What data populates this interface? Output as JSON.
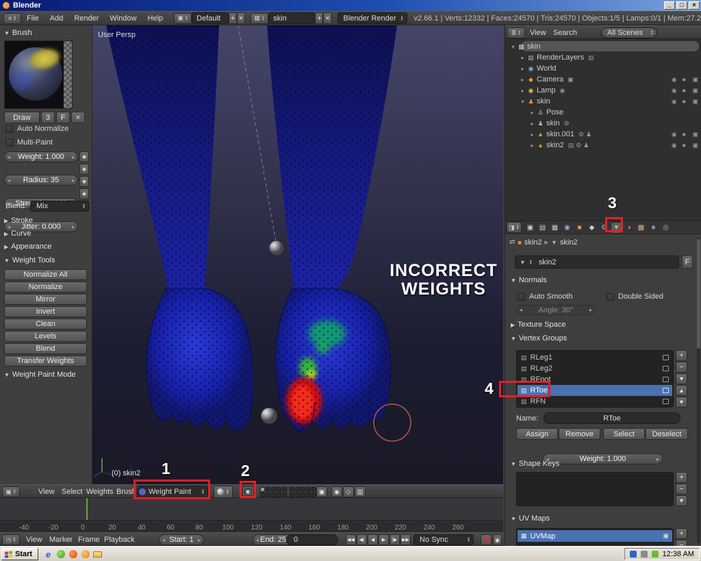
{
  "icons": {
    "minimize": "_",
    "maximize": "□",
    "close": "×",
    "collapse": "▼",
    "expand": "▶",
    "tree_open": "▾",
    "tree_closed": "▸",
    "right": "▸",
    "plus": "+",
    "minus": "−",
    "x": "×",
    "up_small": "▴",
    "down_small": "▾",
    "eye": "◉",
    "cursor": "►",
    "camera_toggle": "▣"
  },
  "titlebar": {
    "title": "Blender"
  },
  "menubar": {
    "menus": [
      "File",
      "Add",
      "Render",
      "Window",
      "Help"
    ],
    "layout_value": "Default",
    "scene_value": "skin",
    "engine_value": "Blender Render",
    "stats": "v2.66.1 | Verts:12332 | Faces:24570 | Tris:24570 | Objects:1/5 | Lamps:0/1 | Mem:27.2"
  },
  "toolshelf": {
    "brush_header": "Brush",
    "draw_button": "Draw",
    "brush_count": "3",
    "fake_user": "F",
    "auto_normalize": "Auto Normalize",
    "multi_paint": "Multi-Paint",
    "weight_slider": "Weight: 1.000",
    "radius_slider": "Radius: 35",
    "strength_slider": "Strength: 1.000",
    "jitter_slider": "Jitter: 0.000",
    "blend_label": "Blend:",
    "blend_value": "Mix",
    "stroke_header": "Stroke",
    "curve_header": "Curve",
    "appearance_header": "Appearance",
    "weight_tools_header": "Weight Tools",
    "tools": [
      "Normalize All",
      "Normalize",
      "Mirror",
      "Invert",
      "Clean",
      "Levels",
      "Blend",
      "Transfer Weights"
    ],
    "weight_paint_mode_header": "Weight Paint Mode"
  },
  "viewport": {
    "view_label": "User Persp",
    "object_label": "(0) skin2",
    "annotation": {
      "line1": "INCORRECT",
      "line2": "WEIGHTS"
    },
    "callouts": {
      "c1": "1",
      "c2": "2",
      "c3": "3",
      "c4": "4"
    }
  },
  "vp_header": {
    "menus": [
      "View",
      "Select",
      "Weights",
      "Brush"
    ],
    "mode_value": "Weight Paint"
  },
  "timeline": {
    "ticks": [
      "-40",
      "-20",
      "0",
      "20",
      "40",
      "60",
      "80",
      "100",
      "120",
      "140",
      "160",
      "180",
      "200",
      "220",
      "240",
      "260"
    ],
    "menus": [
      "View",
      "Marker",
      "Frame",
      "Playback"
    ],
    "start_field": "Start: 1",
    "end_field": "End: 250",
    "frame_field": "0",
    "playback": [
      "◀◀",
      "◀|",
      "◀",
      "▶",
      "|▶",
      "▶▶"
    ],
    "sync_value": "No Sync"
  },
  "outliner": {
    "menus": [
      "View",
      "Search"
    ],
    "filter_value": "All Scenes",
    "rows": [
      {
        "label": "skin"
      },
      {
        "label": "RenderLayers"
      },
      {
        "label": "World"
      },
      {
        "label": "Camera"
      },
      {
        "label": "Lamp"
      },
      {
        "label": "skin"
      },
      {
        "label": "Pose"
      },
      {
        "label": "skin"
      },
      {
        "label": "skin.001"
      },
      {
        "label": "skin2"
      }
    ]
  },
  "properties": {
    "breadcrumb": {
      "object": "skin2",
      "data": "skin2"
    },
    "name_value": "skin2",
    "fake_user": "F",
    "normals_header": "Normals",
    "auto_smooth": "Auto Smooth",
    "double_sided": "Double Sided",
    "angle_slider": "Angle: 30°",
    "texture_space_header": "Texture Space",
    "vertex_groups_header": "Vertex Groups",
    "vertex_groups": [
      {
        "label": "RLeg1"
      },
      {
        "label": "RLeg2"
      },
      {
        "label": "RFoot"
      },
      {
        "label": "RToe"
      },
      {
        "label": "RFN"
      }
    ],
    "name_label": "Name:",
    "group_name_value": "RToe",
    "assign_button": "Assign",
    "remove_button": "Remove",
    "select_button": "Select",
    "deselect_button": "Deselect",
    "weight_slider": "Weight: 1.000",
    "shape_keys_header": "Shape Keys",
    "uv_maps_header": "UV Maps",
    "uv_map_name": "UVMap"
  },
  "taskbar": {
    "start_label": "Start",
    "clock": "12:38 AM"
  }
}
